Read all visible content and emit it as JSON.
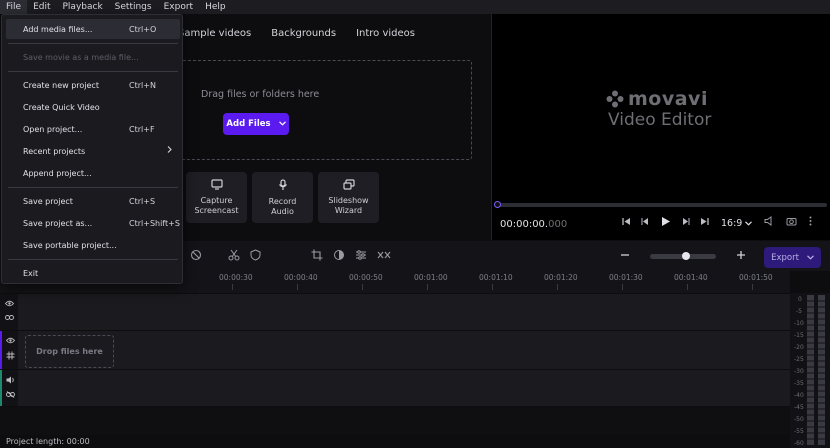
{
  "menubar": {
    "items": [
      "File",
      "Edit",
      "Playback",
      "Settings",
      "Export",
      "Help"
    ]
  },
  "file_menu": {
    "items": [
      {
        "label": "Add media files...",
        "shortcut": "Ctrl+O"
      },
      {
        "label": "Save movie as a media file...",
        "shortcut": ""
      },
      {
        "label": "Create new project",
        "shortcut": "Ctrl+N"
      },
      {
        "label": "Create Quick Video",
        "shortcut": ""
      },
      {
        "label": "Open project...",
        "shortcut": "Ctrl+F"
      },
      {
        "label": "Recent projects",
        "shortcut": ""
      },
      {
        "label": "Append project...",
        "shortcut": ""
      },
      {
        "label": "Save project",
        "shortcut": "Ctrl+S"
      },
      {
        "label": "Save project as...",
        "shortcut": "Ctrl+Shift+S"
      },
      {
        "label": "Save portable project...",
        "shortcut": ""
      },
      {
        "label": "Exit",
        "shortcut": ""
      }
    ]
  },
  "import": {
    "tabs": [
      "Sample videos",
      "Backgrounds",
      "Intro videos"
    ],
    "drop_text": "Drag files or folders here",
    "add_files_label": "Add Files",
    "tools": [
      {
        "line1": "Capture",
        "line2": "Screencast",
        "icon": "monitor-icon"
      },
      {
        "line1": "Record",
        "line2": "Audio",
        "icon": "microphone-icon"
      },
      {
        "line1": "Slideshow",
        "line2": "Wizard",
        "icon": "slideshow-icon"
      }
    ]
  },
  "player": {
    "brand": "movavi",
    "product": "Video Editor",
    "timecode_main": "00:00:00.",
    "timecode_ms": "000",
    "aspect_ratio": "16:9"
  },
  "timeline": {
    "export_label": "Export",
    "ruler_ticks": [
      "00:00:30",
      "00:00:40",
      "00:00:50",
      "00:01:00",
      "00:01:10",
      "00:01:20",
      "00:01:30",
      "00:01:40",
      "00:01:50"
    ],
    "drop_files_label": "Drop files here",
    "meter_labels": [
      "0",
      "-5",
      "-10",
      "-15",
      "-20",
      "-25",
      "-30",
      "-35",
      "-40",
      "-45",
      "-50",
      "-55",
      "-60"
    ]
  },
  "footer": {
    "project_length": "Project length: 00:00"
  },
  "colors": {
    "accent": "#5b1bf0",
    "export_bg": "#2e1a7a",
    "background": "#0d0d10"
  }
}
